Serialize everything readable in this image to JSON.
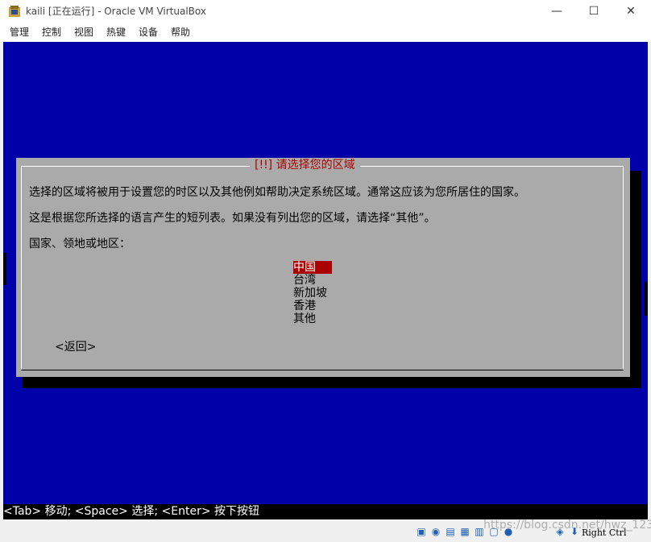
{
  "window": {
    "title": "kaili [正在运行] - Oracle VM VirtualBox",
    "min_glyph": "—",
    "max_glyph": "☐",
    "close_glyph": "✕"
  },
  "menu": [
    "管理",
    "控制",
    "视图",
    "热键",
    "设备",
    "帮助"
  ],
  "dialog": {
    "title": "[!!] 请选择您的区域",
    "line1": "选择的区域将被用于设置您的时区以及其他例如帮助决定系统区域。通常这应该为您所居住的国家。",
    "line2": "这是根据您所选择的语言产生的短列表。如果没有列出您的区域，请选择“其他”。",
    "prompt": "国家、领地或地区：",
    "options": [
      "中国",
      "台湾",
      "新加坡",
      "香港",
      "其他"
    ],
    "selected": "中国",
    "back": "<返回>"
  },
  "hint_bar": "<Tab> 移动; <Space> 选择; <Enter> 按下按钮",
  "statusbar": {
    "host_key": "Right Ctrl",
    "icons": [
      "hard-disk-icon",
      "optical-drive-icon",
      "usb-icon",
      "shared-folder-icon",
      "network-icon",
      "display-icon",
      "recording-icon",
      "mouse-integration-icon",
      "keyboard-icon"
    ]
  },
  "watermark": "https://blog.csdn.net/hwz_123",
  "colors": {
    "vm_background": "#0000a8",
    "dialog_background": "#aaaaaa",
    "accent_red": "#aa0000"
  }
}
